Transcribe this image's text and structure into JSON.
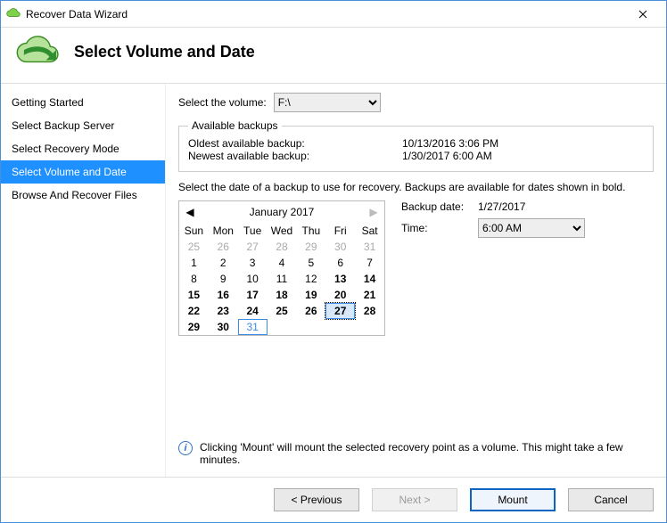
{
  "window": {
    "title": "Recover Data Wizard"
  },
  "headline": "Select Volume and Date",
  "sidebar": {
    "items": [
      {
        "label": "Getting Started",
        "selected": false
      },
      {
        "label": "Select Backup Server",
        "selected": false
      },
      {
        "label": "Select Recovery Mode",
        "selected": false
      },
      {
        "label": "Select Volume and Date",
        "selected": true
      },
      {
        "label": "Browse And Recover Files",
        "selected": false
      }
    ]
  },
  "volume": {
    "label": "Select the volume:",
    "value": "F:\\"
  },
  "available": {
    "legend": "Available backups",
    "oldest_label": "Oldest available backup:",
    "oldest_value": "10/13/2016 3:06 PM",
    "newest_label": "Newest available backup:",
    "newest_value": "1/30/2017 6:00 AM"
  },
  "instruction": "Select the date of a backup to use for recovery. Backups are available for dates shown in bold.",
  "backup_date": {
    "label": "Backup date:",
    "value": "1/27/2017"
  },
  "time": {
    "label": "Time:",
    "value": "6:00 AM"
  },
  "calendar": {
    "title": "January 2017",
    "dow": [
      "Sun",
      "Mon",
      "Tue",
      "Wed",
      "Thu",
      "Fri",
      "Sat"
    ],
    "cells": [
      {
        "n": 25,
        "other": true
      },
      {
        "n": 26,
        "other": true
      },
      {
        "n": 27,
        "other": true
      },
      {
        "n": 28,
        "other": true
      },
      {
        "n": 29,
        "other": true
      },
      {
        "n": 30,
        "other": true
      },
      {
        "n": 31,
        "other": true
      },
      {
        "n": 1
      },
      {
        "n": 2
      },
      {
        "n": 3
      },
      {
        "n": 4
      },
      {
        "n": 5
      },
      {
        "n": 6
      },
      {
        "n": 7
      },
      {
        "n": 8
      },
      {
        "n": 9
      },
      {
        "n": 10
      },
      {
        "n": 11
      },
      {
        "n": 12
      },
      {
        "n": 13,
        "bold": true
      },
      {
        "n": 14,
        "bold": true
      },
      {
        "n": 15,
        "bold": true
      },
      {
        "n": 16,
        "bold": true
      },
      {
        "n": 17,
        "bold": true
      },
      {
        "n": 18,
        "bold": true
      },
      {
        "n": 19,
        "bold": true
      },
      {
        "n": 20,
        "bold": true
      },
      {
        "n": 21,
        "bold": true
      },
      {
        "n": 22,
        "bold": true
      },
      {
        "n": 23,
        "bold": true
      },
      {
        "n": 24,
        "bold": true
      },
      {
        "n": 25,
        "bold": true
      },
      {
        "n": 26,
        "bold": true
      },
      {
        "n": 27,
        "bold": true,
        "selected": true
      },
      {
        "n": 28,
        "bold": true
      },
      {
        "n": 29,
        "bold": true
      },
      {
        "n": 30,
        "bold": true
      },
      {
        "n": 31,
        "today": true
      },
      {
        "n": "",
        "empty": true
      },
      {
        "n": "",
        "empty": true
      },
      {
        "n": "",
        "empty": true
      },
      {
        "n": "",
        "empty": true
      }
    ]
  },
  "note": "Clicking 'Mount' will mount the selected recovery point as a volume. This might take a few minutes.",
  "buttons": {
    "previous": "< Previous",
    "next": "Next >",
    "mount": "Mount",
    "cancel": "Cancel"
  }
}
